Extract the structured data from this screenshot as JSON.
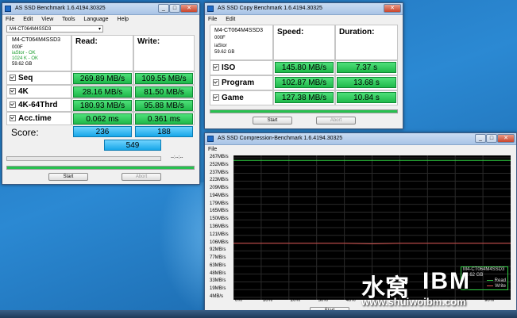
{
  "bench_window": {
    "title": "AS SSD Benchmark 1.6.4194.30325",
    "menu": [
      "File",
      "Edit",
      "View",
      "Tools",
      "Language",
      "Help"
    ],
    "drive_select": "M4-CT064M4SSD3",
    "drive_info": [
      "M4-CT064M4SSD3",
      "000F",
      "iaStor - OK",
      "1024 K - OK",
      "59.62 GB"
    ],
    "col_read": "Read:",
    "col_write": "Write:",
    "rows": [
      {
        "label": "Seq",
        "read": "269.89 MB/s",
        "write": "109.55 MB/s"
      },
      {
        "label": "4K",
        "read": "28.16 MB/s",
        "write": "81.50 MB/s"
      },
      {
        "label": "4K-64Thrd",
        "read": "180.93 MB/s",
        "write": "95.88 MB/s"
      },
      {
        "label": "Acc.time",
        "read": "0.062 ms",
        "write": "0.361 ms"
      }
    ],
    "score_label": "Score:",
    "score_read": "236",
    "score_write": "188",
    "score_total": "549",
    "progress_time": "--:--:--",
    "progress": 1.0,
    "start": "Start",
    "abort": "Abort"
  },
  "copy_window": {
    "title": "AS SSD Copy Benchmark 1.6.4194.30325",
    "menu": [
      "File",
      "Edit"
    ],
    "drive_info": [
      "M4-CT064M4SSD3",
      "000F",
      "iaStor",
      "59.62 GB"
    ],
    "col_speed": "Speed:",
    "col_duration": "Duration:",
    "rows": [
      {
        "label": "ISO",
        "speed": "145.80 MB/s",
        "duration": "7.37 s"
      },
      {
        "label": "Program",
        "speed": "102.87 MB/s",
        "duration": "13.68 s"
      },
      {
        "label": "Game",
        "speed": "127.38 MB/s",
        "duration": "10.84 s"
      }
    ],
    "progress": 1.0,
    "start": "Start",
    "abort": "Abort"
  },
  "compression_window": {
    "title": "AS SSD Compression-Benchmark 1.6.4194.30325",
    "menu": [
      "File"
    ],
    "y_labels": [
      "267MB/s",
      "252MB/s",
      "237MB/s",
      "223MB/s",
      "209MB/s",
      "194MB/s",
      "179MB/s",
      "165MB/s",
      "150MB/s",
      "136MB/s",
      "121MB/s",
      "106MB/s",
      "92MB/s",
      "77MB/s",
      "63MB/s",
      "48MB/s",
      "33MB/s",
      "19MB/s",
      "4MB/s"
    ],
    "x_labels": [
      "0%",
      "10%",
      "20%",
      "30%",
      "40%",
      "50%",
      "60%",
      "70%",
      "80%",
      "90%"
    ],
    "legend_drive": "M4-CT064M4SSD3",
    "legend_size": "59.62 GB",
    "legend_read": "Read",
    "legend_write": "Write",
    "start": "Start",
    "colors": {
      "read": "#2ecc40",
      "write": "#d9534f"
    }
  },
  "chart_data": {
    "type": "line",
    "x": [
      0,
      10,
      20,
      30,
      40,
      50,
      60,
      70,
      80,
      90,
      100
    ],
    "series": [
      {
        "name": "Read",
        "values": [
          262,
          262,
          262,
          262,
          262,
          262,
          262,
          262,
          262,
          262,
          262
        ]
      },
      {
        "name": "Write",
        "values": [
          106,
          106,
          106,
          106,
          106,
          105,
          106,
          106,
          106,
          106,
          106
        ]
      }
    ],
    "ylim": [
      4,
      267
    ],
    "xlabel": "",
    "ylabel": ""
  },
  "watermark": {
    "cn": "水窝",
    "brand": "IBM",
    "url": "www.shuiwoibm.com"
  }
}
